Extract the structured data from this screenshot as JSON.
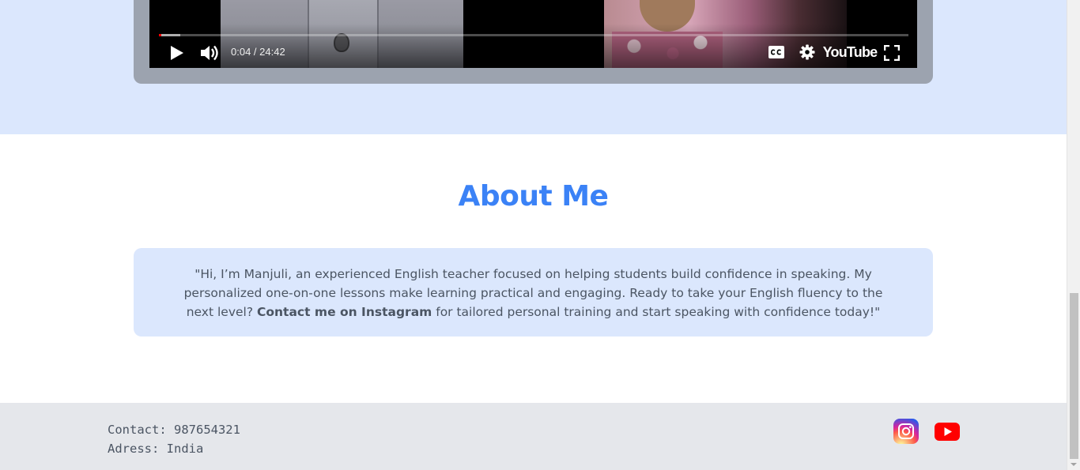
{
  "video": {
    "current_time": "0:04",
    "duration": "24:42",
    "time_display": "0:04 / 24:42",
    "progress_fraction": 0.0027,
    "buffer_fraction": 0.028,
    "brand": "YouTube",
    "icons": [
      "play-icon",
      "volume-icon",
      "closed-captions-icon",
      "settings-gear-icon",
      "fullscreen-icon"
    ]
  },
  "about": {
    "title": "About Me",
    "text_before": "\"Hi, I’m Manjuli, an experienced English teacher focused on helping students build confidence in speaking. My personalized one-on-one lessons make learning practical and engaging. Ready to take your English fluency to the next level? ",
    "text_bold": "Contact me on Instagram",
    "text_after": " for tailored personal training and start speaking with confidence today!\""
  },
  "footer": {
    "contact": "Contact: 987654321",
    "address": "Adress: India",
    "social": [
      "instagram-icon",
      "youtube-icon"
    ]
  },
  "colors": {
    "accent": "#3b82f6",
    "section_bg": "#dbe7fd",
    "footer_bg": "#e5e7eb",
    "text": "#4b5563"
  }
}
